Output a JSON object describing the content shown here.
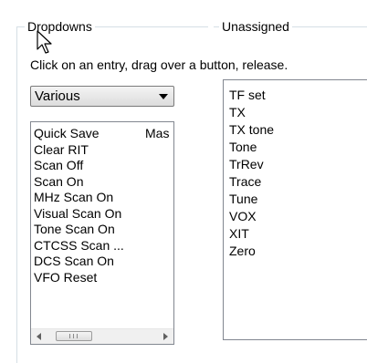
{
  "groups": {
    "dropdowns_title": "Dropdowns",
    "unassigned_title": "Unassigned"
  },
  "instructions": "Click on an entry, drag over a button, release.",
  "combo": {
    "selected": "Various"
  },
  "left_list": {
    "col1": [
      "Quick Save",
      "Clear RIT",
      "Scan Off",
      "Scan On",
      "MHz Scan On",
      "Visual Scan On",
      "Tone Scan On",
      "CTCSS Scan ...",
      "DCS Scan On",
      "VFO Reset"
    ],
    "col2": [
      "Mas"
    ]
  },
  "scrollbar": {
    "grip_label": "III"
  },
  "right_list": {
    "items": [
      "TF set",
      "TX",
      "TX tone",
      "Tone",
      "TrRev",
      "Trace",
      "Tune",
      "VOX",
      "XIT",
      "Zero"
    ]
  },
  "icons": {
    "combo_arrow": "chevron-down-icon",
    "scroll_left": "arrow-left-icon",
    "scroll_right": "arrow-right-icon",
    "cursor": "mouse-pointer-icon"
  }
}
